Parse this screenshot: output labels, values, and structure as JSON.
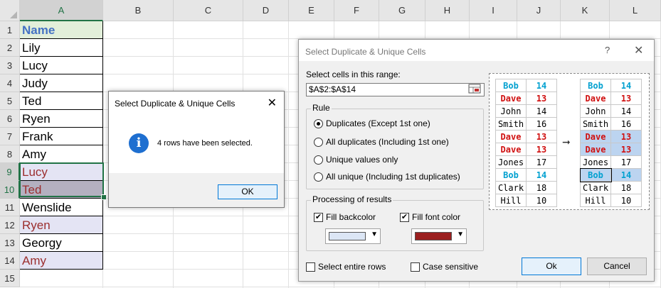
{
  "columns": [
    "A",
    "B",
    "C",
    "D",
    "E",
    "F",
    "G",
    "H",
    "I",
    "J",
    "K",
    "L"
  ],
  "rows": [
    "1",
    "2",
    "3",
    "4",
    "5",
    "6",
    "7",
    "8",
    "9",
    "10",
    "11",
    "12",
    "13",
    "14",
    "15"
  ],
  "cells": [
    {
      "text": "Name",
      "style": "header"
    },
    {
      "text": "Lily",
      "style": "normal"
    },
    {
      "text": "Lucy",
      "style": "normal"
    },
    {
      "text": "Judy",
      "style": "normal"
    },
    {
      "text": "Ted",
      "style": "normal"
    },
    {
      "text": "Ryen",
      "style": "normal"
    },
    {
      "text": "Frank",
      "style": "normal"
    },
    {
      "text": "Amy",
      "style": "normal"
    },
    {
      "text": "Lucy",
      "style": "dup"
    },
    {
      "text": "Ted",
      "style": "dupactive"
    },
    {
      "text": "Wenslide",
      "style": "normal"
    },
    {
      "text": "Ryen",
      "style": "dup"
    },
    {
      "text": "Georgy",
      "style": "normal"
    },
    {
      "text": "Amy",
      "style": "dup"
    }
  ],
  "colors": {
    "header_bg": "#e2efda",
    "header_fg": "#4472c4",
    "dup_bg": "#e4e4f4",
    "dup_fg": "#9b2e2e",
    "active_bg": "#b4b0c0",
    "fill_backcolor": "#dce6f5",
    "fill_fontcolor": "#9b2020"
  },
  "info_dialog": {
    "title": "Select Duplicate & Unique Cells",
    "close": "✕",
    "icon": "i",
    "message": "4 rows have been selected.",
    "ok_label": "OK"
  },
  "main_dialog": {
    "title": "Select Duplicate & Unique Cells",
    "help": "?",
    "close": "✕",
    "range_label": "Select cells in this range:",
    "range_value": "$A$2:$A$14",
    "rule": {
      "title": "Rule",
      "options": [
        {
          "label": "Duplicates (Except 1st one)",
          "checked": true
        },
        {
          "label": "All duplicates (Including 1st one)",
          "checked": false
        },
        {
          "label": "Unique values only",
          "checked": false
        },
        {
          "label": "All unique (Including 1st duplicates)",
          "checked": false
        }
      ]
    },
    "processing": {
      "title": "Processing of results",
      "fill_backcolor_label": "Fill backcolor",
      "fill_fontcolor_label": "Fill font color",
      "fill_backcolor_checked": true,
      "fill_fontcolor_checked": true
    },
    "select_entire_rows_label": "Select entire rows",
    "case_sensitive_label": "Case sensitive",
    "ok_label": "Ok",
    "cancel_label": "Cancel",
    "preview": {
      "left": [
        {
          "n": "Bob",
          "v": "14",
          "c": "cyan"
        },
        {
          "n": "Dave",
          "v": "13",
          "c": "red"
        },
        {
          "n": "John",
          "v": "14",
          "c": "plain"
        },
        {
          "n": "Smith",
          "v": "16",
          "c": "plain"
        },
        {
          "n": "Dave",
          "v": "13",
          "c": "red"
        },
        {
          "n": "Dave",
          "v": "13",
          "c": "red"
        },
        {
          "n": "Jones",
          "v": "17",
          "c": "plain"
        },
        {
          "n": "Bob",
          "v": "14",
          "c": "cyan"
        },
        {
          "n": "Clark",
          "v": "18",
          "c": "plain"
        },
        {
          "n": "Hill",
          "v": "10",
          "c": "plain"
        }
      ],
      "right": [
        {
          "n": "Bob",
          "v": "14",
          "c": "cyan"
        },
        {
          "n": "Dave",
          "v": "13",
          "c": "red"
        },
        {
          "n": "John",
          "v": "14",
          "c": "plain"
        },
        {
          "n": "Smith",
          "v": "16",
          "c": "plain"
        },
        {
          "n": "Dave",
          "v": "13",
          "c": "redhl"
        },
        {
          "n": "Dave",
          "v": "13",
          "c": "redhl"
        },
        {
          "n": "Jones",
          "v": "17",
          "c": "plain"
        },
        {
          "n": "Bob",
          "v": "14",
          "c": "cyanhl"
        },
        {
          "n": "Clark",
          "v": "18",
          "c": "plain"
        },
        {
          "n": "Hill",
          "v": "10",
          "c": "plain"
        }
      ]
    }
  }
}
